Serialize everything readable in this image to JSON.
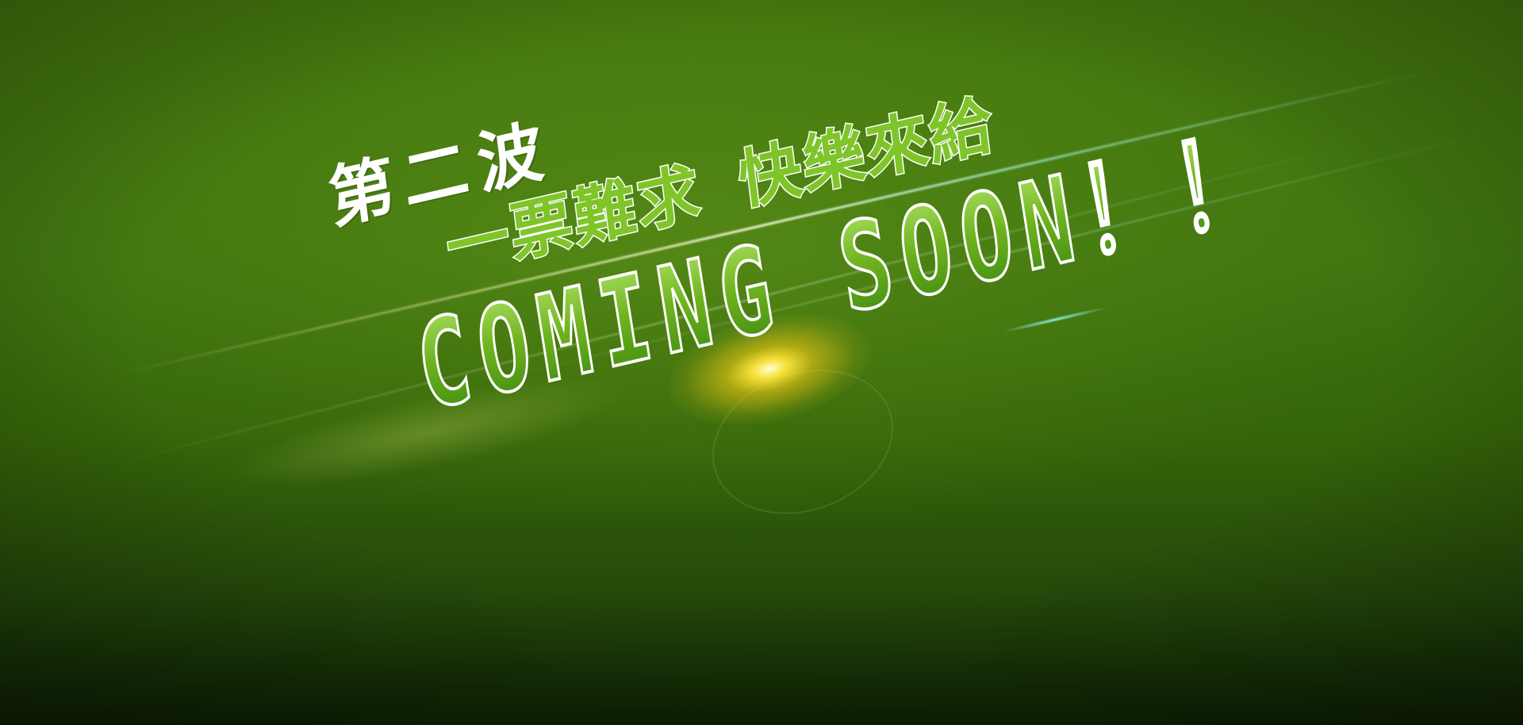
{
  "banner": {
    "wave_label": "第二波",
    "slogan_part1": "一票難求",
    "slogan_part2": "快樂來給",
    "coming_soon": "COMING SOON！！"
  },
  "colors": {
    "background_top": "#45790e",
    "background_bottom": "#0f2204",
    "accent_green": "#7fc52a",
    "text_white": "#ffffff",
    "flare_yellow": "#ffe63c"
  }
}
